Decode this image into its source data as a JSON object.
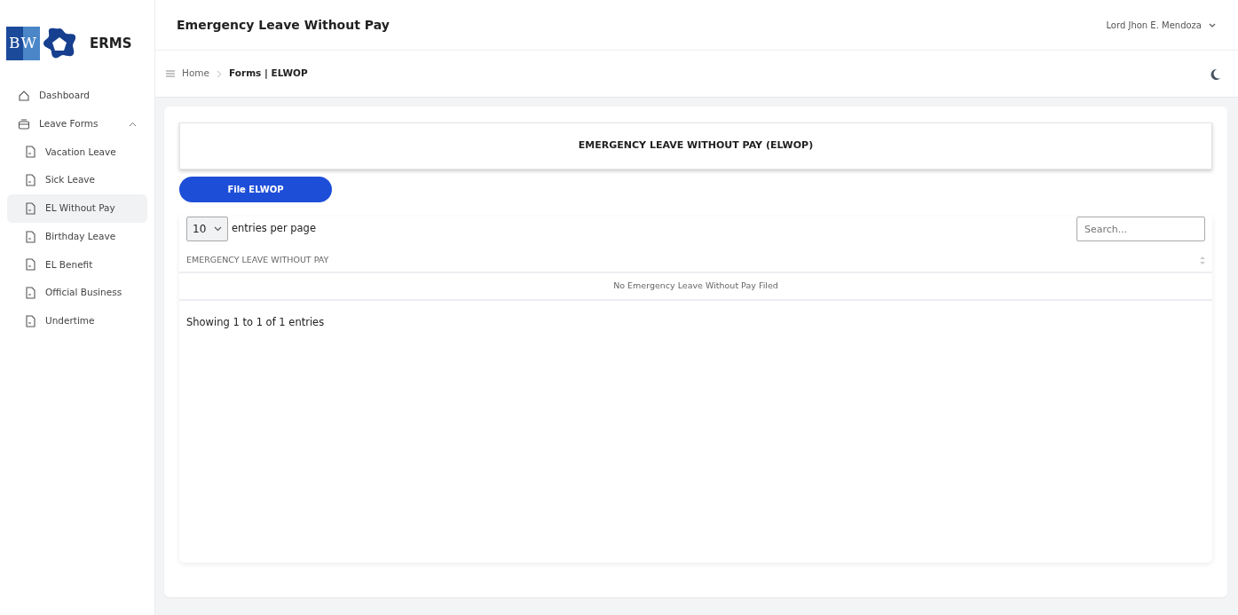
{
  "brand": {
    "logo_text": "BW",
    "name": "ERMS"
  },
  "sidebar": {
    "items": [
      {
        "label": "Dashboard",
        "selected": false
      },
      {
        "label": "Leave Forms",
        "selected": false,
        "expanded": true,
        "children": [
          {
            "label": "Vacation Leave",
            "selected": false
          },
          {
            "label": "Sick Leave",
            "selected": false
          },
          {
            "label": "EL Without Pay",
            "selected": true
          },
          {
            "label": "Birthday Leave",
            "selected": false
          },
          {
            "label": "EL Benefit",
            "selected": false
          },
          {
            "label": "Official Business",
            "selected": false
          },
          {
            "label": "Undertime",
            "selected": false
          }
        ]
      }
    ]
  },
  "header": {
    "title": "Emergency Leave Without Pay",
    "user": "Lord Jhon E. Mendoza"
  },
  "breadcrumb": [
    "Home",
    "Forms | ELWOP"
  ],
  "form_title": "EMERGENCY LEAVE WITHOUT PAY (ELWOP)",
  "file_button": "File ELWOP",
  "table": {
    "page_size": "10",
    "page_size_label": "entries per page",
    "search": {
      "placeholder": "Search..."
    },
    "columns": [
      "EMERGENCY LEAVE WITHOUT PAY"
    ],
    "empty_message": "No Emergency Leave Without Pay Filed",
    "info": "Showing 1 to 1 of 1 entries"
  }
}
